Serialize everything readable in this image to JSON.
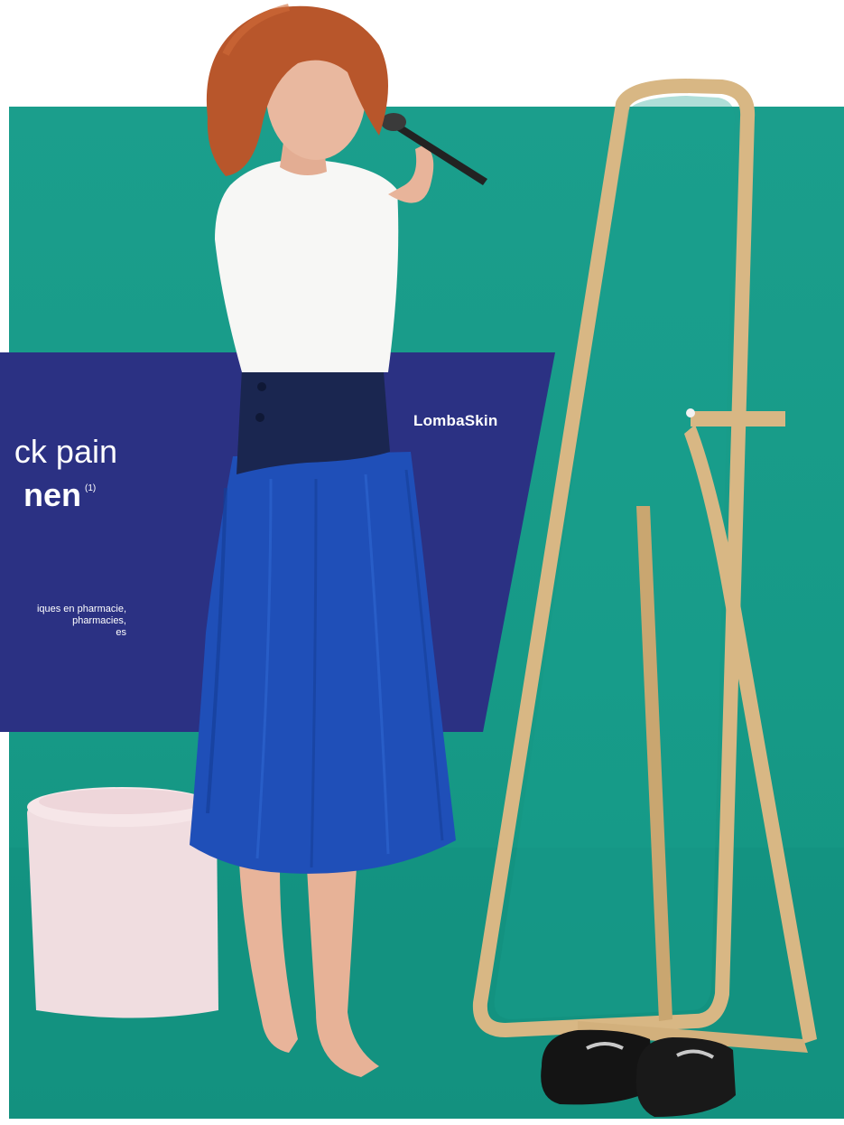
{
  "panel": {
    "headline_line1": "ck pain",
    "headline_line2": "nen",
    "footnote_mark": "(1)",
    "fine_print": [
      "iques en pharmacie,",
      "pharmacies,",
      "es"
    ],
    "brand": "LombaSkin"
  },
  "colors": {
    "background": "#1b9e8c",
    "panel": "#2b3183",
    "text": "#ffffff"
  }
}
